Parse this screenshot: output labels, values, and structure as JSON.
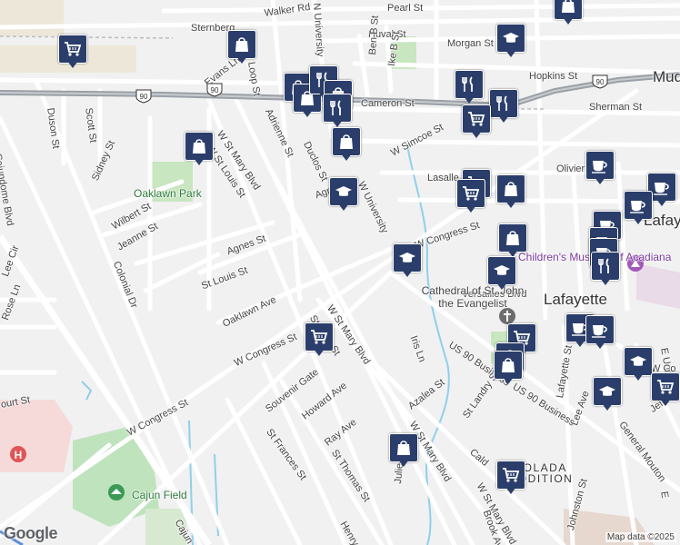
{
  "map": {
    "attribution": "Map data ©2025",
    "logo": "Google",
    "colors": {
      "background": "#f1f1f1",
      "road": "#ffffff",
      "highway": "#9aa0a6",
      "park": "#c8e6c0",
      "water": "#8fd0ea",
      "marker": "#2b3e6b",
      "hospital": "#e05555",
      "stadium": "#bfe3bc"
    },
    "labels": {
      "pearl_st": "Pearl St",
      "walker_rd": "Walker Rd",
      "sternberg": "Sternberg",
      "huval_st": "Huval St",
      "morgan_st": "Morgan St",
      "hopkins_st": "Hopkins St",
      "mudd": "Mudd",
      "evans_ln": "Evans Ln",
      "s_loop_st": "S Loop St",
      "n_university": "N University",
      "ben_b_st": "Ben B St",
      "ike_b_st": "Ike B St",
      "cameron_st": "Cameron St",
      "sherman_st": "Sherman St",
      "duson_st": "Duson St",
      "scott_st": "Scott St",
      "cajundome_blvd": "Cajundome Blvd",
      "adrienne_st": "Adrienne St",
      "duclos_st": "Duclos St",
      "w_simcoe_st": "W Simcoe St",
      "olivier_st": "Olivier St",
      "lasalle": "Lasalle",
      "w_st_mary_blvd_top": "W St Mary Blvd",
      "st_louis_st_top": "W St Louis St",
      "sidney_st": "Sidney St",
      "oaklawn_park": "Oaklawn Park",
      "wilbert_st": "Wilbert St",
      "jeanne_st": "Jeanne St",
      "colonial_dr": "Colonial Dr",
      "agnes_st": "Agnes St",
      "agnes_st_2": "Agnes St",
      "w_university": "W University",
      "w_congress_st_top": "W Congress St",
      "lafayette_top": "Lafayet",
      "childrens_museum": "Children's Museum of Acadiana",
      "lafayette_city": "Lafayette",
      "versailles_blvd": "Versailles Blvd",
      "st_louis_st": "St Louis St",
      "oaklawn_ave": "Oaklawn Ave",
      "cathedral": "Cathedral of St. John the Evangelist",
      "w_st_mary_blvd_mid": "W St Mary Blvd",
      "st_john_st": "St John St",
      "iris_ln": "Iris Ln",
      "us_90_business": "US 90 Business",
      "us_90_business_2": "US 90 Business",
      "w_congress_st_mid": "W Congress St",
      "souvenir_gate": "Souvenir Gate",
      "howard_ave": "Howard Ave",
      "azalea_st": "Azalea St",
      "st_landry_st": "St Landry St",
      "lafayette_st": "Lafayette St",
      "lee_ave": "Lee Ave",
      "jefferson": "Jefferso",
      "ray_ave": "Ray Ave",
      "w_st_mary_blvd_low": "W St Mary Blvd",
      "st_frances_st": "St Frances St",
      "st_thomas_st": "St Thomas St",
      "w_congress_st_low": "W Congress St",
      "cajun_field": "Cajun Field",
      "general_mouton": "General Mouton",
      "saint_julien": "Julien",
      "caldwell": "Cald",
      "w_st_mary_blvd_bottom": "W St Mary Blvd",
      "johnston_st": "Johnston St",
      "brook_ave": "Brook Ave",
      "henry": "Henry",
      "cajun_bottom": "Cajun",
      "lee_cir": "Lee Cir",
      "rose_ln": "Rose Ln",
      "ourt_st": "ourt St",
      "e_univ": "E Univ",
      "e_univ_2": "E",
      "jefferson_2": "W Co",
      "sabolada": "SABOLADA",
      "addition": "ADDITION",
      "rbolada": "RBOLADA"
    },
    "shields": [
      "90",
      "90",
      "90"
    ]
  }
}
